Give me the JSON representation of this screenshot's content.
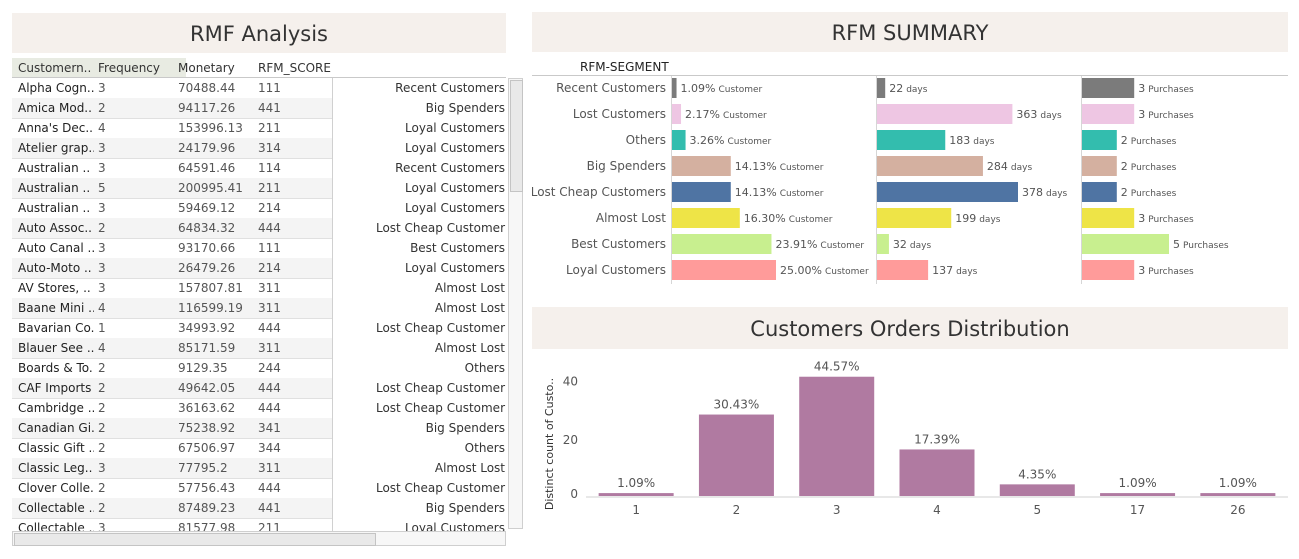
{
  "rmf_analysis": {
    "title": "RMF Analysis",
    "columns": [
      "Customern..",
      "Frequency",
      "Monetary",
      "RFM_SCORE"
    ],
    "rows": [
      [
        "Alpha Cogn..",
        "3",
        "70488.44",
        "111",
        "Recent Customers"
      ],
      [
        "Amica Mod..",
        "2",
        "94117.26",
        "441",
        "Big Spenders"
      ],
      [
        "Anna's Dec..",
        "4",
        "153996.13",
        "211",
        "Loyal Customers"
      ],
      [
        "Atelier grap..",
        "3",
        "24179.96",
        "314",
        "Loyal Customers"
      ],
      [
        "Australian ..",
        "3",
        "64591.46",
        "114",
        "Recent Customers"
      ],
      [
        "Australian ..",
        "5",
        "200995.41",
        "211",
        "Loyal Customers"
      ],
      [
        "Australian ..",
        "3",
        "59469.12",
        "214",
        "Loyal Customers"
      ],
      [
        "Auto Assoc..",
        "2",
        "64834.32",
        "444",
        "Lost Cheap Customer"
      ],
      [
        "Auto Canal ..",
        "3",
        "93170.66",
        "111",
        "Best Customers"
      ],
      [
        "Auto-Moto ..",
        "3",
        "26479.26",
        "214",
        "Loyal Customers"
      ],
      [
        "AV Stores, ..",
        "3",
        "157807.81",
        "311",
        "Almost Lost"
      ],
      [
        "Baane Mini ..",
        "4",
        "116599.19",
        "311",
        "Almost Lost"
      ],
      [
        "Bavarian Co..",
        "1",
        "34993.92",
        "444",
        "Lost Cheap Customer"
      ],
      [
        "Blauer See ..",
        "4",
        "85171.59",
        "311",
        "Almost Lost"
      ],
      [
        "Boards & To..",
        "2",
        "9129.35",
        "244",
        "Others"
      ],
      [
        "CAF Imports",
        "2",
        "49642.05",
        "444",
        "Lost Cheap Customer"
      ],
      [
        "Cambridge ..",
        "2",
        "36163.62",
        "444",
        "Lost Cheap Customer"
      ],
      [
        "Canadian Gi..",
        "2",
        "75238.92",
        "341",
        "Big Spenders"
      ],
      [
        "Classic Gift ..",
        "2",
        "67506.97",
        "344",
        "Others"
      ],
      [
        "Classic Leg..",
        "3",
        "77795.2",
        "311",
        "Almost Lost"
      ],
      [
        "Clover Colle..",
        "2",
        "57756.43",
        "444",
        "Lost Cheap Customer"
      ],
      [
        "Collectable ..",
        "2",
        "87489.23",
        "441",
        "Big Spenders"
      ],
      [
        "Collectable ..",
        "3",
        "81577.98",
        "211",
        "Loyal Customers"
      ]
    ]
  },
  "chart_data": [
    {
      "type": "bar",
      "title": "RFM SUMMARY",
      "segment_header": "RFM-SEGMENT",
      "categories": [
        "Recent Customers",
        "Lost Customers",
        "Others",
        "Big Spenders",
        "Lost Cheap Customers",
        "Almost Lost",
        "Best Customers",
        "Loyal Customers"
      ],
      "colors": [
        "#7b7b7b",
        "#eec6e3",
        "#33bdae",
        "#d4b0a0",
        "#4f74a3",
        "#eee447",
        "#c8ef8f",
        "#ff9b9a"
      ],
      "series": [
        {
          "name": "Customer",
          "values": [
            1.09,
            2.17,
            3.26,
            14.13,
            14.13,
            16.3,
            23.91,
            25.0
          ],
          "labels": [
            "1.09%",
            "2.17%",
            "3.26%",
            "14.13%",
            "14.13%",
            "16.30%",
            "23.91%",
            "25.00%"
          ],
          "unit": "Customer",
          "max": 25.0
        },
        {
          "name": "days",
          "values": [
            22,
            363,
            183,
            284,
            378,
            199,
            32,
            137
          ],
          "labels": [
            "22",
            "363",
            "183",
            "284",
            "378",
            "199",
            "32",
            "137"
          ],
          "unit": "days",
          "max": 378
        },
        {
          "name": "Purchases",
          "values": [
            3,
            3,
            2,
            2,
            2,
            3,
            5,
            3
          ],
          "labels": [
            "3",
            "3",
            "2",
            "2",
            "2",
            "3",
            "5",
            "3"
          ],
          "unit": "Purchases",
          "max": 5
        }
      ]
    },
    {
      "type": "bar",
      "title": "Customers Orders Distribution",
      "ylabel": "Distinct count of Custo..",
      "categories": [
        "1",
        "2",
        "3",
        "4",
        "5",
        "17",
        "26"
      ],
      "values": [
        1,
        28,
        41,
        16,
        4,
        1,
        1
      ],
      "labels": [
        "1.09%",
        "30.43%",
        "44.57%",
        "17.39%",
        "4.35%",
        "1.09%",
        "1.09%"
      ],
      "yticks": [
        "0",
        "20",
        "40"
      ],
      "ylim": [
        0,
        44
      ],
      "color": "#b07aa1"
    }
  ]
}
